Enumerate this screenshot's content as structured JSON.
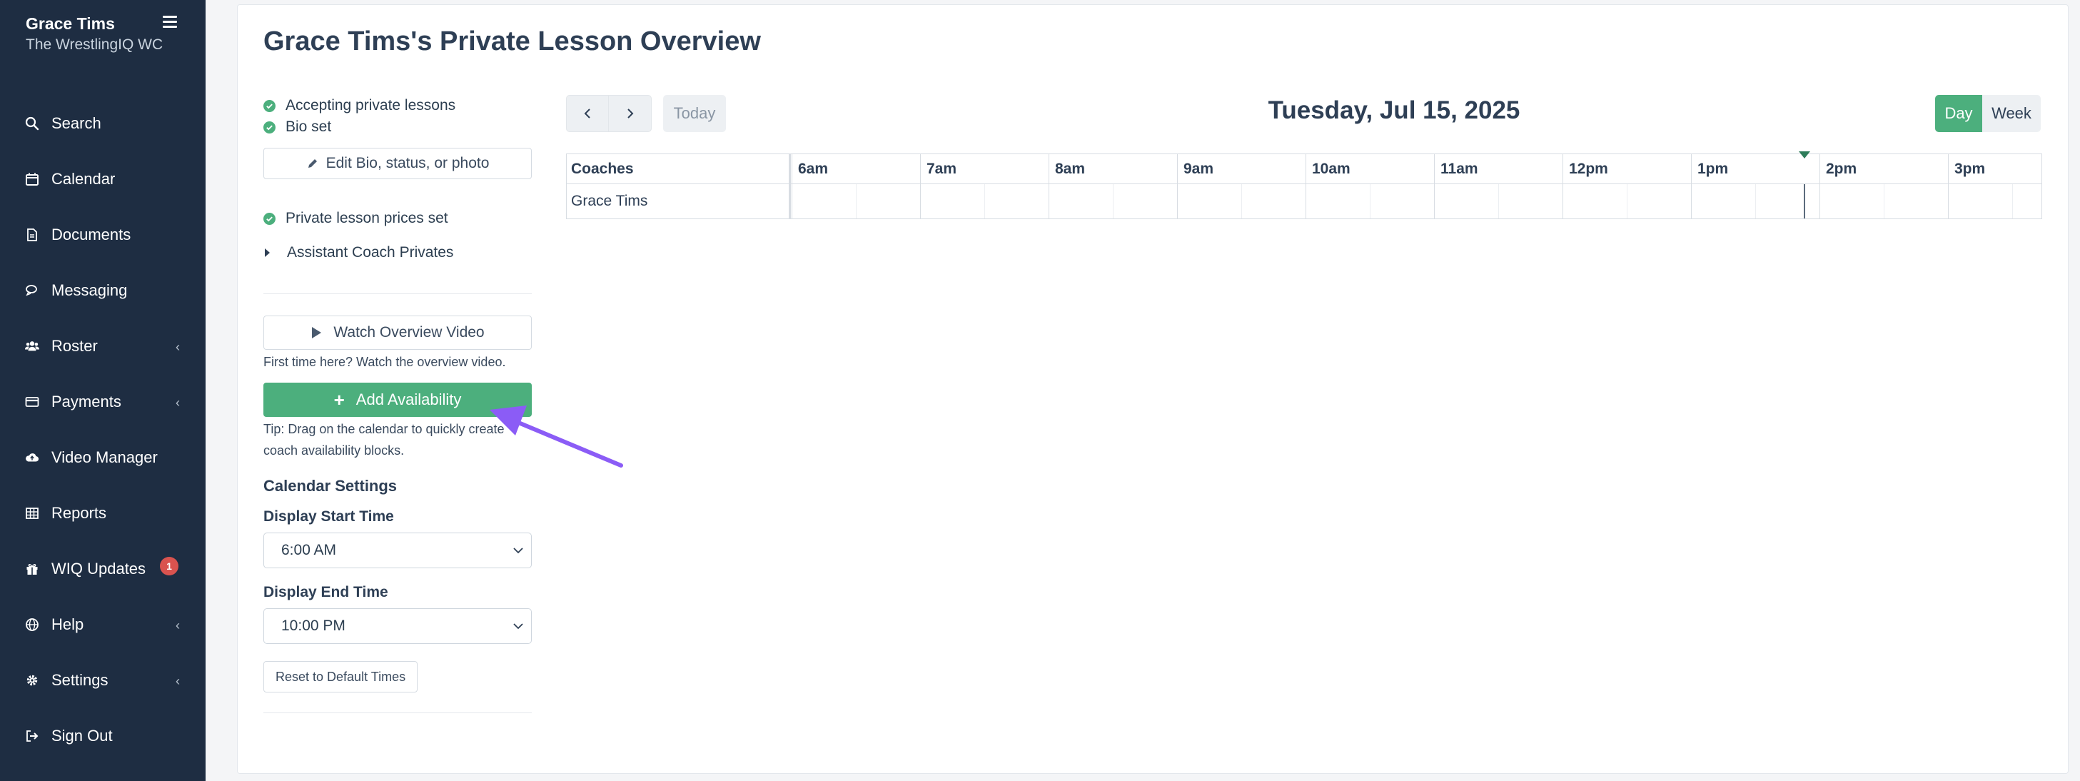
{
  "sidebar": {
    "user_name": "Grace Tims",
    "org_name": "The WrestlingIQ WC",
    "items": [
      {
        "label": "Search",
        "icon": "search-icon",
        "has_submenu": false
      },
      {
        "label": "Calendar",
        "icon": "calendar-icon",
        "has_submenu": false
      },
      {
        "label": "Documents",
        "icon": "document-icon",
        "has_submenu": false
      },
      {
        "label": "Messaging",
        "icon": "chat-icon",
        "has_submenu": false
      },
      {
        "label": "Roster",
        "icon": "users-icon",
        "has_submenu": true
      },
      {
        "label": "Payments",
        "icon": "credit-card-icon",
        "has_submenu": true
      },
      {
        "label": "Video Manager",
        "icon": "cloud-icon",
        "has_submenu": false
      },
      {
        "label": "Reports",
        "icon": "table-icon",
        "has_submenu": false
      },
      {
        "label": "WIQ Updates",
        "icon": "gift-icon",
        "has_submenu": false,
        "badge": "1"
      },
      {
        "label": "Help",
        "icon": "globe-icon",
        "has_submenu": true
      },
      {
        "label": "Settings",
        "icon": "gear-icon",
        "has_submenu": true
      },
      {
        "label": "Sign Out",
        "icon": "sign-out-icon",
        "has_submenu": false
      }
    ]
  },
  "page": {
    "title": "Grace Tims's Private Lesson Overview"
  },
  "status": {
    "accepting": "Accepting private lessons",
    "bio_set": "Bio set",
    "edit_bio_button": "Edit Bio, status, or photo",
    "prices_set": "Private lesson prices set",
    "assistant_privates": "Assistant Coach Privates"
  },
  "actions": {
    "watch_video_button": "Watch Overview Video",
    "watch_video_hint": "First time here? Watch the overview video.",
    "add_availability_button": "Add Availability",
    "tip_line1": "Tip: Drag on the calendar to quickly create",
    "tip_line2": "coach availability blocks."
  },
  "calendar_settings": {
    "title": "Calendar Settings",
    "start_label": "Display Start Time",
    "start_value": "6:00 AM",
    "end_label": "Display End Time",
    "end_value": "10:00 PM",
    "reset_button": "Reset to Default Times"
  },
  "calendar": {
    "today_button": "Today",
    "date_title": "Tuesday, Jul 15, 2025",
    "view_day": "Day",
    "view_week": "Week",
    "active_view": "Day",
    "resource_header": "Coaches",
    "hours": [
      "6am",
      "7am",
      "8am",
      "9am",
      "10am",
      "11am",
      "12pm",
      "1pm",
      "2pm",
      "3pm"
    ],
    "rows": [
      {
        "name": "Grace Tims"
      }
    ],
    "now_fraction_of_hour_1pm": 0.88
  },
  "colors": {
    "sidebar_bg": "#1e2d42",
    "accent_green": "#4caf7d",
    "badge_red": "#d9534f",
    "annotation_arrow": "#8b5cf6"
  }
}
